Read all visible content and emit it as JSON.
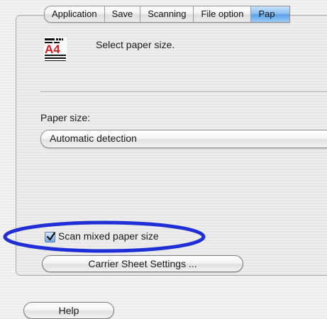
{
  "tabs": [
    {
      "label": "Application"
    },
    {
      "label": "Save"
    },
    {
      "label": "Scanning"
    },
    {
      "label": "File option"
    },
    {
      "label": "Pap"
    }
  ],
  "header": {
    "icon_label": "A4",
    "text": "Select paper size."
  },
  "paper_size": {
    "label": "Paper size:",
    "selected": "Automatic detection"
  },
  "scan_mixed": {
    "label": "Scan mixed paper size",
    "checked": true
  },
  "carrier_button": {
    "label": "Carrier Sheet Settings ..."
  },
  "help_button": {
    "label": "Help"
  },
  "colors": {
    "accent": "#5aa1e8",
    "annotation": "#1f2ed6",
    "icon_red": "#d41f1f"
  }
}
